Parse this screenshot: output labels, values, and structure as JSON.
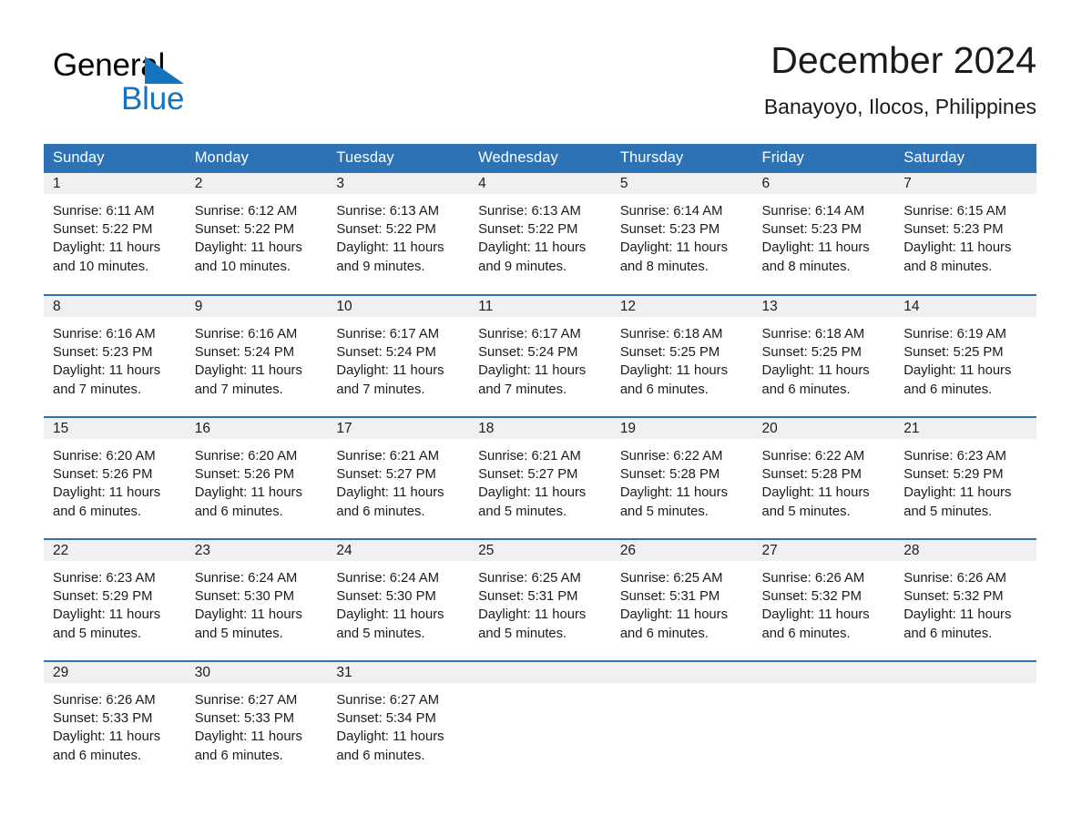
{
  "brand": {
    "name_part1": "General",
    "name_part2": "Blue",
    "triangle_icon": "triangle-icon",
    "color_blue": "#1673c0",
    "color_black": "#000000"
  },
  "header": {
    "title": "December 2024",
    "subtitle": "Banayoyo, Ilocos, Philippines"
  },
  "theme": {
    "header_bg": "#2c72b4",
    "header_text": "#ffffff",
    "daynum_bg": "#f0f0f0",
    "row_border": "#2c72b4",
    "body_text": "#1b1b1b"
  },
  "calendar": {
    "weekdays": [
      "Sunday",
      "Monday",
      "Tuesday",
      "Wednesday",
      "Thursday",
      "Friday",
      "Saturday"
    ],
    "weeks": [
      [
        {
          "day": "1",
          "sunrise": "Sunrise: 6:11 AM",
          "sunset": "Sunset: 5:22 PM",
          "daylight1": "Daylight: 11 hours",
          "daylight2": "and 10 minutes."
        },
        {
          "day": "2",
          "sunrise": "Sunrise: 6:12 AM",
          "sunset": "Sunset: 5:22 PM",
          "daylight1": "Daylight: 11 hours",
          "daylight2": "and 10 minutes."
        },
        {
          "day": "3",
          "sunrise": "Sunrise: 6:13 AM",
          "sunset": "Sunset: 5:22 PM",
          "daylight1": "Daylight: 11 hours",
          "daylight2": "and 9 minutes."
        },
        {
          "day": "4",
          "sunrise": "Sunrise: 6:13 AM",
          "sunset": "Sunset: 5:22 PM",
          "daylight1": "Daylight: 11 hours",
          "daylight2": "and 9 minutes."
        },
        {
          "day": "5",
          "sunrise": "Sunrise: 6:14 AM",
          "sunset": "Sunset: 5:23 PM",
          "daylight1": "Daylight: 11 hours",
          "daylight2": "and 8 minutes."
        },
        {
          "day": "6",
          "sunrise": "Sunrise: 6:14 AM",
          "sunset": "Sunset: 5:23 PM",
          "daylight1": "Daylight: 11 hours",
          "daylight2": "and 8 minutes."
        },
        {
          "day": "7",
          "sunrise": "Sunrise: 6:15 AM",
          "sunset": "Sunset: 5:23 PM",
          "daylight1": "Daylight: 11 hours",
          "daylight2": "and 8 minutes."
        }
      ],
      [
        {
          "day": "8",
          "sunrise": "Sunrise: 6:16 AM",
          "sunset": "Sunset: 5:23 PM",
          "daylight1": "Daylight: 11 hours",
          "daylight2": "and 7 minutes."
        },
        {
          "day": "9",
          "sunrise": "Sunrise: 6:16 AM",
          "sunset": "Sunset: 5:24 PM",
          "daylight1": "Daylight: 11 hours",
          "daylight2": "and 7 minutes."
        },
        {
          "day": "10",
          "sunrise": "Sunrise: 6:17 AM",
          "sunset": "Sunset: 5:24 PM",
          "daylight1": "Daylight: 11 hours",
          "daylight2": "and 7 minutes."
        },
        {
          "day": "11",
          "sunrise": "Sunrise: 6:17 AM",
          "sunset": "Sunset: 5:24 PM",
          "daylight1": "Daylight: 11 hours",
          "daylight2": "and 7 minutes."
        },
        {
          "day": "12",
          "sunrise": "Sunrise: 6:18 AM",
          "sunset": "Sunset: 5:25 PM",
          "daylight1": "Daylight: 11 hours",
          "daylight2": "and 6 minutes."
        },
        {
          "day": "13",
          "sunrise": "Sunrise: 6:18 AM",
          "sunset": "Sunset: 5:25 PM",
          "daylight1": "Daylight: 11 hours",
          "daylight2": "and 6 minutes."
        },
        {
          "day": "14",
          "sunrise": "Sunrise: 6:19 AM",
          "sunset": "Sunset: 5:25 PM",
          "daylight1": "Daylight: 11 hours",
          "daylight2": "and 6 minutes."
        }
      ],
      [
        {
          "day": "15",
          "sunrise": "Sunrise: 6:20 AM",
          "sunset": "Sunset: 5:26 PM",
          "daylight1": "Daylight: 11 hours",
          "daylight2": "and 6 minutes."
        },
        {
          "day": "16",
          "sunrise": "Sunrise: 6:20 AM",
          "sunset": "Sunset: 5:26 PM",
          "daylight1": "Daylight: 11 hours",
          "daylight2": "and 6 minutes."
        },
        {
          "day": "17",
          "sunrise": "Sunrise: 6:21 AM",
          "sunset": "Sunset: 5:27 PM",
          "daylight1": "Daylight: 11 hours",
          "daylight2": "and 6 minutes."
        },
        {
          "day": "18",
          "sunrise": "Sunrise: 6:21 AM",
          "sunset": "Sunset: 5:27 PM",
          "daylight1": "Daylight: 11 hours",
          "daylight2": "and 5 minutes."
        },
        {
          "day": "19",
          "sunrise": "Sunrise: 6:22 AM",
          "sunset": "Sunset: 5:28 PM",
          "daylight1": "Daylight: 11 hours",
          "daylight2": "and 5 minutes."
        },
        {
          "day": "20",
          "sunrise": "Sunrise: 6:22 AM",
          "sunset": "Sunset: 5:28 PM",
          "daylight1": "Daylight: 11 hours",
          "daylight2": "and 5 minutes."
        },
        {
          "day": "21",
          "sunrise": "Sunrise: 6:23 AM",
          "sunset": "Sunset: 5:29 PM",
          "daylight1": "Daylight: 11 hours",
          "daylight2": "and 5 minutes."
        }
      ],
      [
        {
          "day": "22",
          "sunrise": "Sunrise: 6:23 AM",
          "sunset": "Sunset: 5:29 PM",
          "daylight1": "Daylight: 11 hours",
          "daylight2": "and 5 minutes."
        },
        {
          "day": "23",
          "sunrise": "Sunrise: 6:24 AM",
          "sunset": "Sunset: 5:30 PM",
          "daylight1": "Daylight: 11 hours",
          "daylight2": "and 5 minutes."
        },
        {
          "day": "24",
          "sunrise": "Sunrise: 6:24 AM",
          "sunset": "Sunset: 5:30 PM",
          "daylight1": "Daylight: 11 hours",
          "daylight2": "and 5 minutes."
        },
        {
          "day": "25",
          "sunrise": "Sunrise: 6:25 AM",
          "sunset": "Sunset: 5:31 PM",
          "daylight1": "Daylight: 11 hours",
          "daylight2": "and 5 minutes."
        },
        {
          "day": "26",
          "sunrise": "Sunrise: 6:25 AM",
          "sunset": "Sunset: 5:31 PM",
          "daylight1": "Daylight: 11 hours",
          "daylight2": "and 6 minutes."
        },
        {
          "day": "27",
          "sunrise": "Sunrise: 6:26 AM",
          "sunset": "Sunset: 5:32 PM",
          "daylight1": "Daylight: 11 hours",
          "daylight2": "and 6 minutes."
        },
        {
          "day": "28",
          "sunrise": "Sunrise: 6:26 AM",
          "sunset": "Sunset: 5:32 PM",
          "daylight1": "Daylight: 11 hours",
          "daylight2": "and 6 minutes."
        }
      ],
      [
        {
          "day": "29",
          "sunrise": "Sunrise: 6:26 AM",
          "sunset": "Sunset: 5:33 PM",
          "daylight1": "Daylight: 11 hours",
          "daylight2": "and 6 minutes."
        },
        {
          "day": "30",
          "sunrise": "Sunrise: 6:27 AM",
          "sunset": "Sunset: 5:33 PM",
          "daylight1": "Daylight: 11 hours",
          "daylight2": "and 6 minutes."
        },
        {
          "day": "31",
          "sunrise": "Sunrise: 6:27 AM",
          "sunset": "Sunset: 5:34 PM",
          "daylight1": "Daylight: 11 hours",
          "daylight2": "and 6 minutes."
        },
        {
          "day": "",
          "sunrise": "",
          "sunset": "",
          "daylight1": "",
          "daylight2": ""
        },
        {
          "day": "",
          "sunrise": "",
          "sunset": "",
          "daylight1": "",
          "daylight2": ""
        },
        {
          "day": "",
          "sunrise": "",
          "sunset": "",
          "daylight1": "",
          "daylight2": ""
        },
        {
          "day": "",
          "sunrise": "",
          "sunset": "",
          "daylight1": "",
          "daylight2": ""
        }
      ]
    ]
  }
}
